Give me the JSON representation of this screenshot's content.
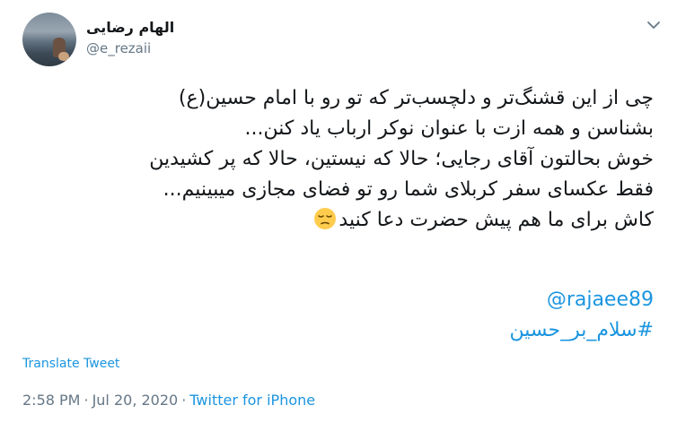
{
  "user": {
    "display_name": "الهام رضایی",
    "handle": "@e_rezaii"
  },
  "icons": {
    "avatar": "avatar-photo",
    "caret": "chevron-down-icon",
    "emoji": "pensive-face-emoji"
  },
  "tweet": {
    "lines": [
      "چی از این قشنگ‌تر و دلچسب‌تر که تو رو با امام حسین(ع)",
      "بشناسن و همه ازت با عنوان نوکر ارباب یاد کنن...",
      "خوش بحالتون آقای رجایی؛ حالا که نیستین، حالا که پر کشیدین",
      "فقط عکسای سفر کربلای شما رو تو فضای مجازی میبینیم...",
      "کاش برای ما هم پیش حضرت دعا کنید"
    ],
    "mention": "@rajaee89",
    "hashtag": "#سلام_بر_حسین"
  },
  "translate_label": "Translate Tweet",
  "meta": {
    "time": "2:58 PM",
    "separator": "·",
    "date": "Jul 20, 2020",
    "source": "Twitter for iPhone"
  },
  "colors": {
    "link": "#1b95e0",
    "muted": "#657786",
    "text": "#14171a"
  }
}
